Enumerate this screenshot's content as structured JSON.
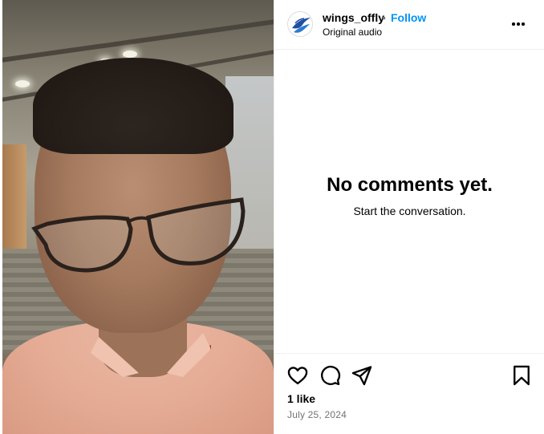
{
  "post": {
    "username": "wings_offly",
    "separator": "•",
    "follow_label": "Follow",
    "audio_label": "Original audio"
  },
  "comments": {
    "empty_title": "No comments yet.",
    "empty_subtitle": "Start the conversation."
  },
  "stats": {
    "likes_label": "1 like",
    "date_label": "July 25, 2024"
  },
  "icons": {
    "more": "more-options-icon",
    "like": "heart-icon",
    "comment": "comment-icon",
    "share": "share-icon",
    "save": "bookmark-icon",
    "avatar": "wings-logo-icon"
  },
  "colors": {
    "follow": "#0095f6",
    "secondary_text": "#737373",
    "divider": "#efefef"
  }
}
